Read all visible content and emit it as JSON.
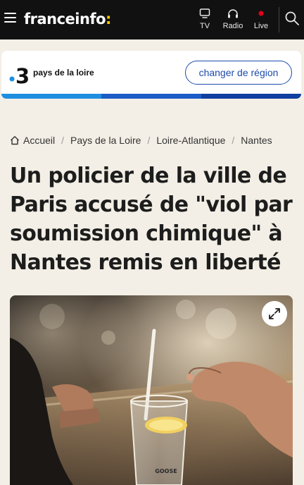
{
  "header": {
    "logo_text": "franceinfo",
    "logo_colon": ":",
    "nav": [
      {
        "label": "TV",
        "icon": "tv-icon"
      },
      {
        "label": "Radio",
        "icon": "headphones-icon"
      },
      {
        "label": "Live",
        "icon": "live-dot-icon"
      }
    ],
    "accent_color": "#ffc700",
    "live_dot_color": "#e4001b"
  },
  "region": {
    "channel_number": "3",
    "name": "pays de la loire",
    "change_button_label": "changer de région",
    "strip_colors": [
      "#1e8fe0",
      "#1d5bc7",
      "#0f3fa0"
    ]
  },
  "breadcrumb": {
    "items": [
      "Accueil",
      "Pays de la Loire",
      "Loire-Atlantique",
      "Nantes"
    ],
    "separator": "/"
  },
  "article": {
    "title": "Un policier de la ville de Paris accusé de \"viol par soumission chimique\" à Nantes remis en liberté"
  },
  "photo": {
    "glass_print": "GOOSE"
  }
}
